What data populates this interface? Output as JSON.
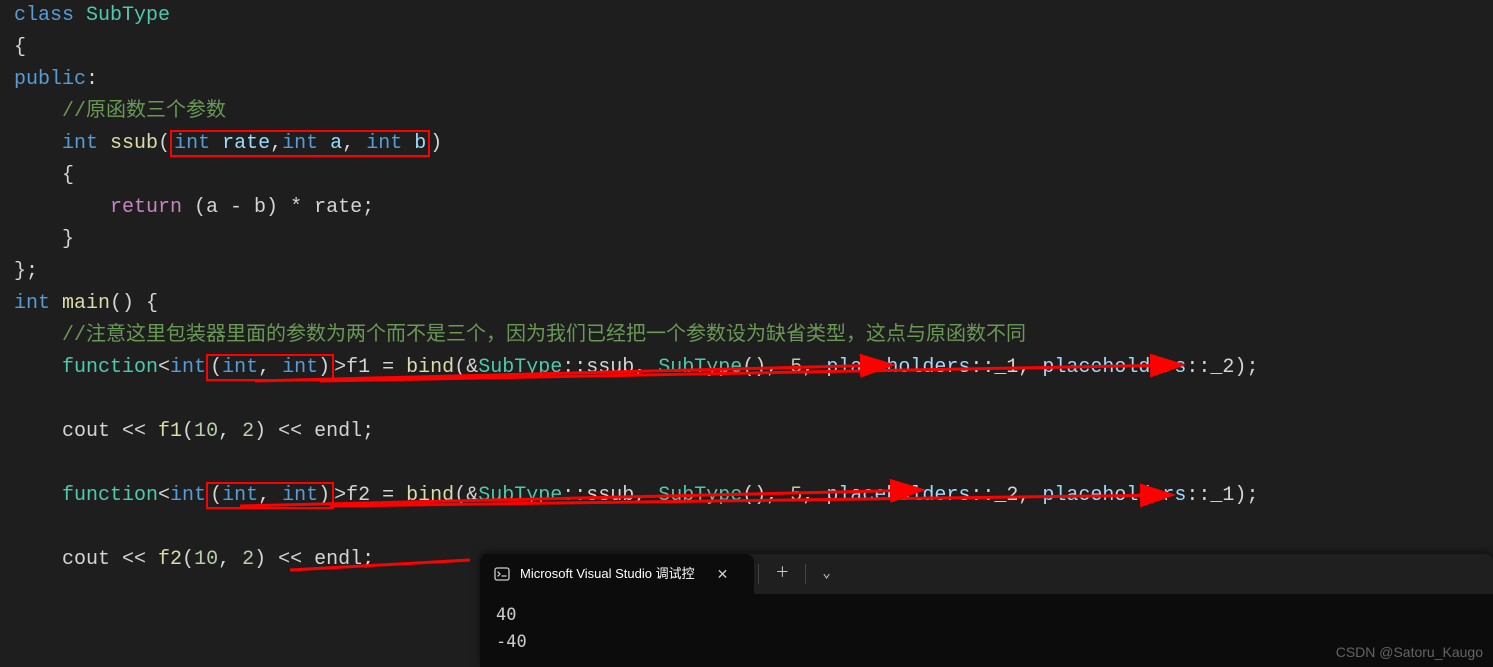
{
  "code": {
    "l1_class": "class",
    "l1_name": "SubType",
    "l2": "{",
    "l3_public": "public",
    "l3_colon": ":",
    "l4_comment": "//原函数三个参数",
    "l5_int": "int",
    "l5_fn": "ssub",
    "l5_p1t": "int",
    "l5_p1n": "rate",
    "l5_c1": ",",
    "l5_p2t": "int",
    "l5_p2n": "a",
    "l5_c2": ", ",
    "l5_p3t": "int",
    "l5_p3n": "b",
    "l6": "    {",
    "l7_return": "return",
    "l7_expr_a": "(a - b) * rate;",
    "l8": "    }",
    "l9": "};",
    "l10_int": "int",
    "l10_main": "main",
    "l10_rest": "() {",
    "l11_comment": "//注意这里包装器里面的参数为两个而不是三个，因为我们已经把一个参数设为缺省类型，这点与原函数不同",
    "l12_func": "function",
    "l12_tparam_int": "int",
    "l12_lp": "(",
    "l12_p1": "int",
    "l12_pc": ", ",
    "l12_p2": "int",
    "l12_rp": ")",
    "l12_rangle": ">",
    "l12_f1": "f1 = ",
    "l12_bind": "bind",
    "l12_args_a": "(&",
    "l12_subtype1": "SubType",
    "l12_cc": "::",
    "l12_ssub": "ssub",
    "l12_args_b": ", ",
    "l12_subtype2": "SubType",
    "l12_args_c": "(), ",
    "l12_five": "5",
    "l12_args_d": ", ",
    "l12_ph1": "placeholders",
    "l12_ph1s": "::_1",
    "l12_args_e": ", ",
    "l12_ph2": "placeholders",
    "l12_ph2s": "::_2",
    "l12_end": ");",
    "l13_cout": "cout << ",
    "l13_f1call": "f1",
    "l13_lp": "(",
    "l13_a1": "10",
    "l13_c": ", ",
    "l13_a2": "2",
    "l13_rp": ") << ",
    "l13_endl": "endl",
    "l13_semi": ";",
    "l14_func": "function",
    "l14_f2": "f2 = ",
    "l14_ph1s": "::_2",
    "l14_ph2s": "::_1",
    "l15_f2call": "f2"
  },
  "terminal": {
    "tab_title": "Microsoft Visual Studio 调试控",
    "out1": "40",
    "out2": "-40"
  },
  "watermark": "CSDN @Satoru_Kaugo"
}
